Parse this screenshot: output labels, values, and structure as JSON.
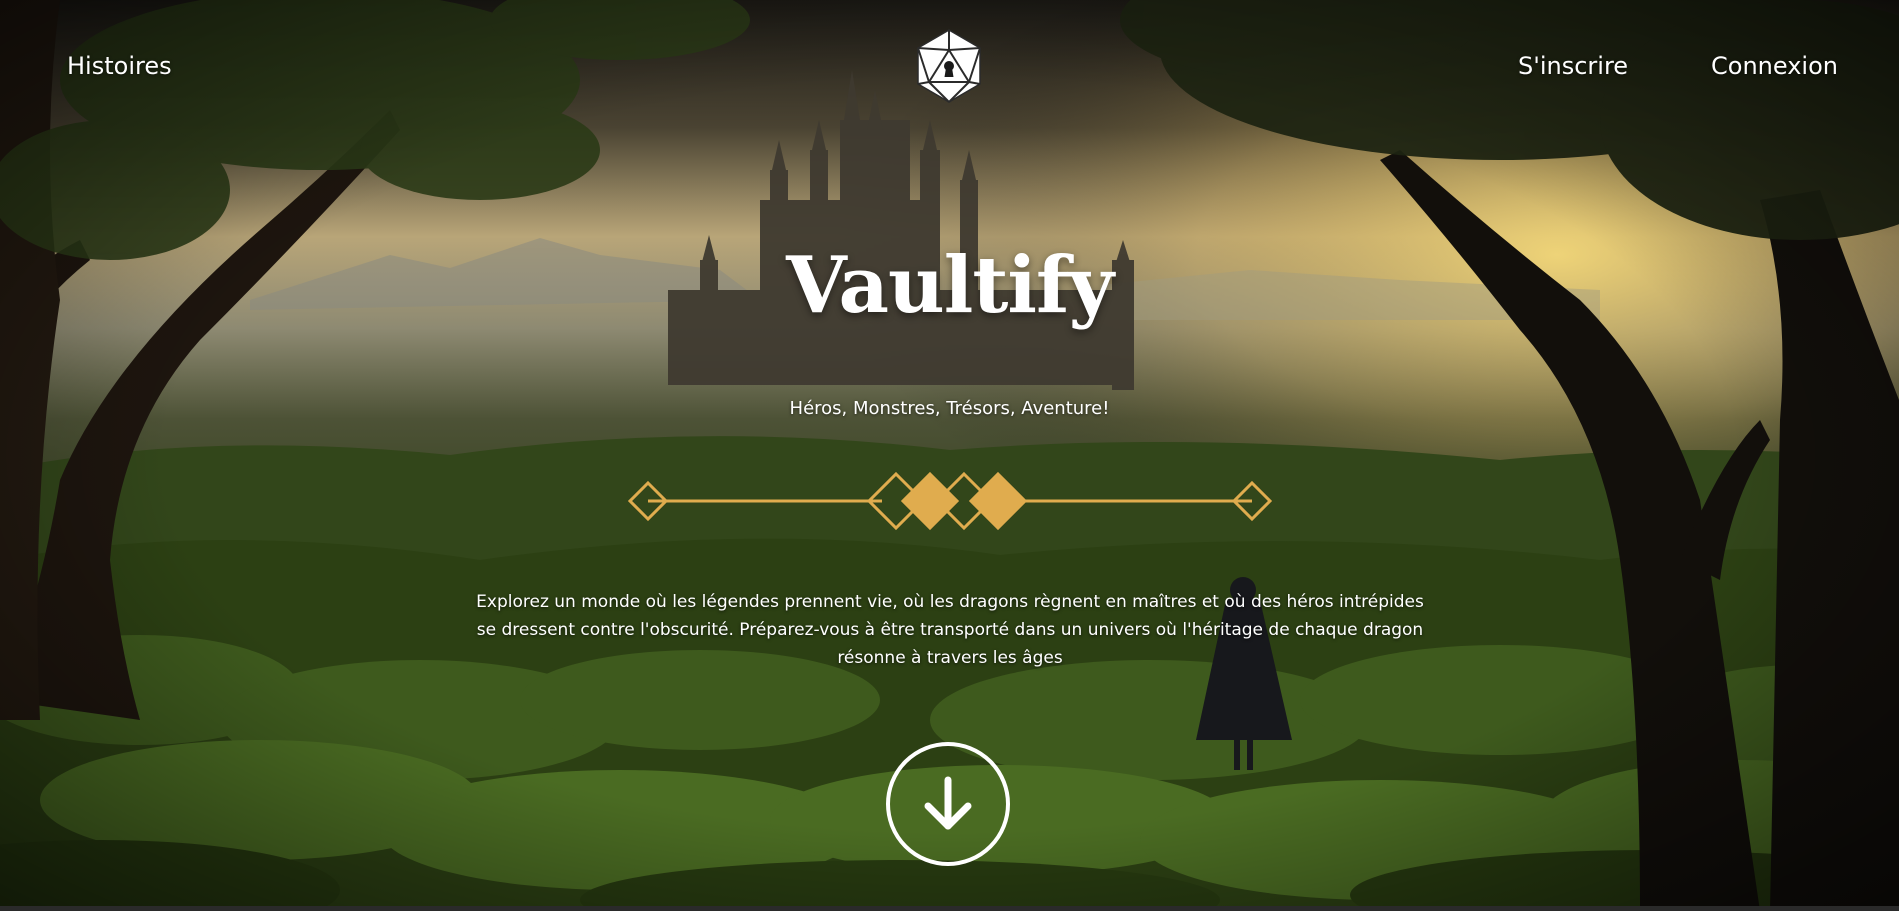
{
  "nav": {
    "left_link": "Histoires",
    "signup": "S'inscrire",
    "login": "Connexion",
    "logo_icon": "d20-lock-icon"
  },
  "hero": {
    "title": "Vaultify",
    "subtitle": "Héros, Monstres, Trésors, Aventure!",
    "description": "Explorez un monde où les légendes prennent vie, où les dragons règnent en maîtres et où des héros intrépides se dressent contre l'obscurité. Préparez-vous à être transporté dans un univers où l'héritage de chaque dragon résonne à travers les âges",
    "scroll_icon": "arrow-down-icon"
  },
  "colors": {
    "accent": "#e0ac4e",
    "text": "#ffffff"
  }
}
